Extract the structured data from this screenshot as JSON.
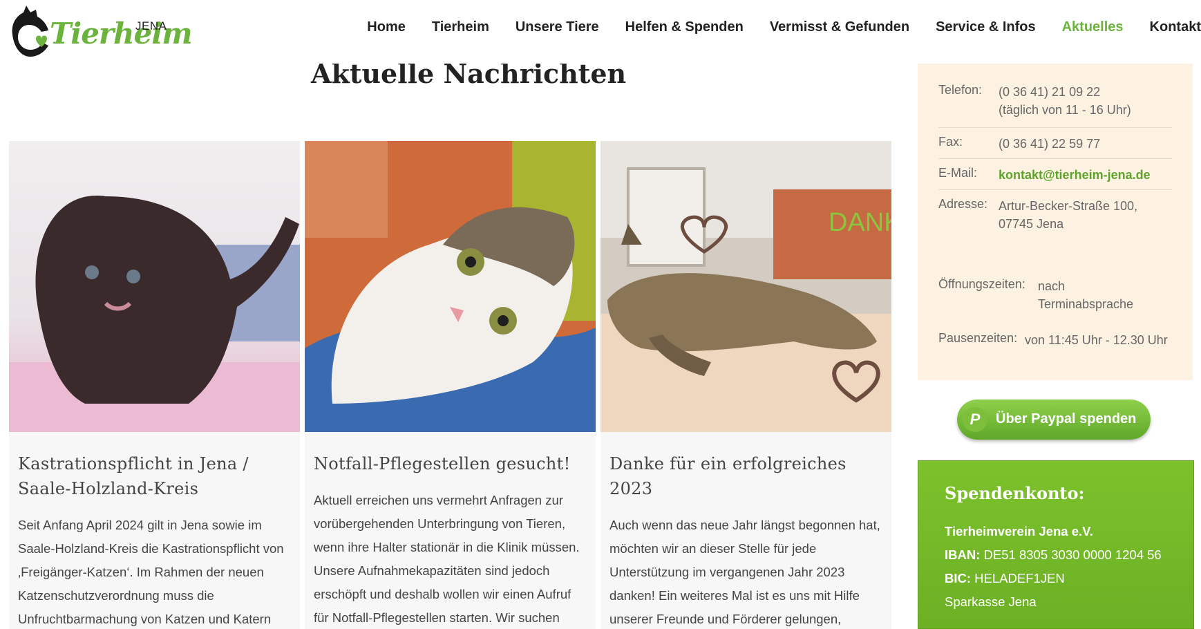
{
  "header": {
    "logo_text": "Tierheim",
    "logo_city": "JENA"
  },
  "nav": [
    {
      "label": "Home",
      "active": false
    },
    {
      "label": "Tierheim",
      "active": false
    },
    {
      "label": "Unsere Tiere",
      "active": false
    },
    {
      "label": "Helfen & Spenden",
      "active": false
    },
    {
      "label": "Vermisst & Gefunden",
      "active": false
    },
    {
      "label": "Service & Infos",
      "active": false
    },
    {
      "label": "Aktuelles",
      "active": true
    },
    {
      "label": "Kontakt",
      "active": false
    }
  ],
  "main": {
    "title": "Aktuelle Nachrichten",
    "cards": [
      {
        "title": "Kastrationspflicht in Jena / Saale-Holzland-Kreis",
        "text": "Seit Anfang April 2024 gilt in Jena sowie im Saale-Holzland-Kreis die Kastrationspflicht von ‚Freigänger-Katzen‘. Im Rahmen der neuen Katzenschutzverordnung muss die Unfruchtbarmachung von Katzen und Katern"
      },
      {
        "title": "Notfall-Pflegestellen gesucht!",
        "text": "Aktuell erreichen uns vermehrt Anfragen zur vorübergehenden Unterbringung von Tieren, wenn ihre Halter stationär in die Klinik müssen. Unsere Aufnahmekapazitäten sind jedoch erschöpft und deshalb wollen wir einen Aufruf für Notfall-Pflegestellen starten. Wir suchen"
      },
      {
        "title": "Danke für ein erfolgreiches 2023",
        "text": "Auch wenn das neue Jahr längst begonnen hat, möchten wir an dieser Stelle für jede Unterstützung im vergangenen Jahr 2023 danken! Ein weiteres Mal ist es uns mit Hilfe unserer Freunde und Förderer gelungen, unseren Verein auf ein solides Fundament zu",
        "image_text": "DANK"
      }
    ]
  },
  "sidebar": {
    "phone_label": "Telefon:",
    "phone_value": "(0 36 41) 21 09 22",
    "phone_hours": "(täglich von 11 - 16 Uhr)",
    "fax_label": "Fax:",
    "fax_value": "(0 36 41) 22 59 77",
    "email_label": "E-Mail:",
    "email_value": "kontakt@tierheim-jena.de",
    "address_label": "Adresse:",
    "address_line1": "Artur-Becker-Straße 100,",
    "address_line2": "07745 Jena",
    "opening_label": "Öffnungszeiten:",
    "opening_value1": "nach",
    "opening_value2": "Terminabsprache",
    "break_label": "Pausenzeiten:",
    "break_value": "von 11:45 Uhr - 12.30 Uhr",
    "paypal_label": "Über Paypal spenden",
    "donation": {
      "heading": "Spendenkonto:",
      "holder": "Tierheimverein Jena e.V.",
      "iban_label": "IBAN:",
      "iban_value": "DE51 8305 3030 0000 1204 56",
      "bic_label": "BIC:",
      "bic_value": "HELADEF1JEN",
      "bank": "Sparkasse Jena"
    }
  },
  "colors": {
    "brand_green": "#6cb33e",
    "sidebar_bg": "#fdf2e1",
    "donation_green": "#76ba2a"
  }
}
